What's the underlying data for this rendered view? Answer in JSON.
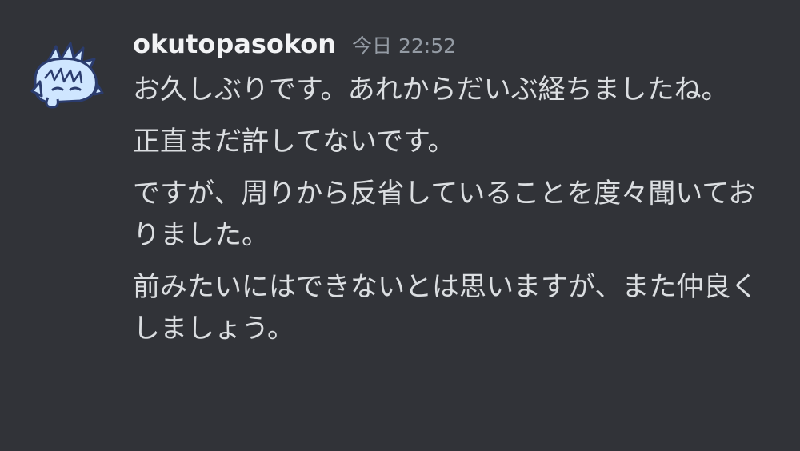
{
  "message": {
    "username": "okutopasokon",
    "timestamp": "今日 22:52",
    "avatar_icon": "anime-character-avatar-icon",
    "lines": [
      "お久しぶりです。あれからだいぶ経ちましたね。",
      "正直まだ許してないです。",
      "ですが、周りから反省していることを度々聞いておりました。",
      "前みたいにはできないとは思いますが、また仲良くしましょう。"
    ]
  },
  "colors": {
    "background": "#313338",
    "username": "#f2f3f5",
    "timestamp": "#949ba4",
    "text": "#dbdee1",
    "avatar_fill": "#cfe6ff",
    "avatar_outline": "#2b3c6e"
  }
}
